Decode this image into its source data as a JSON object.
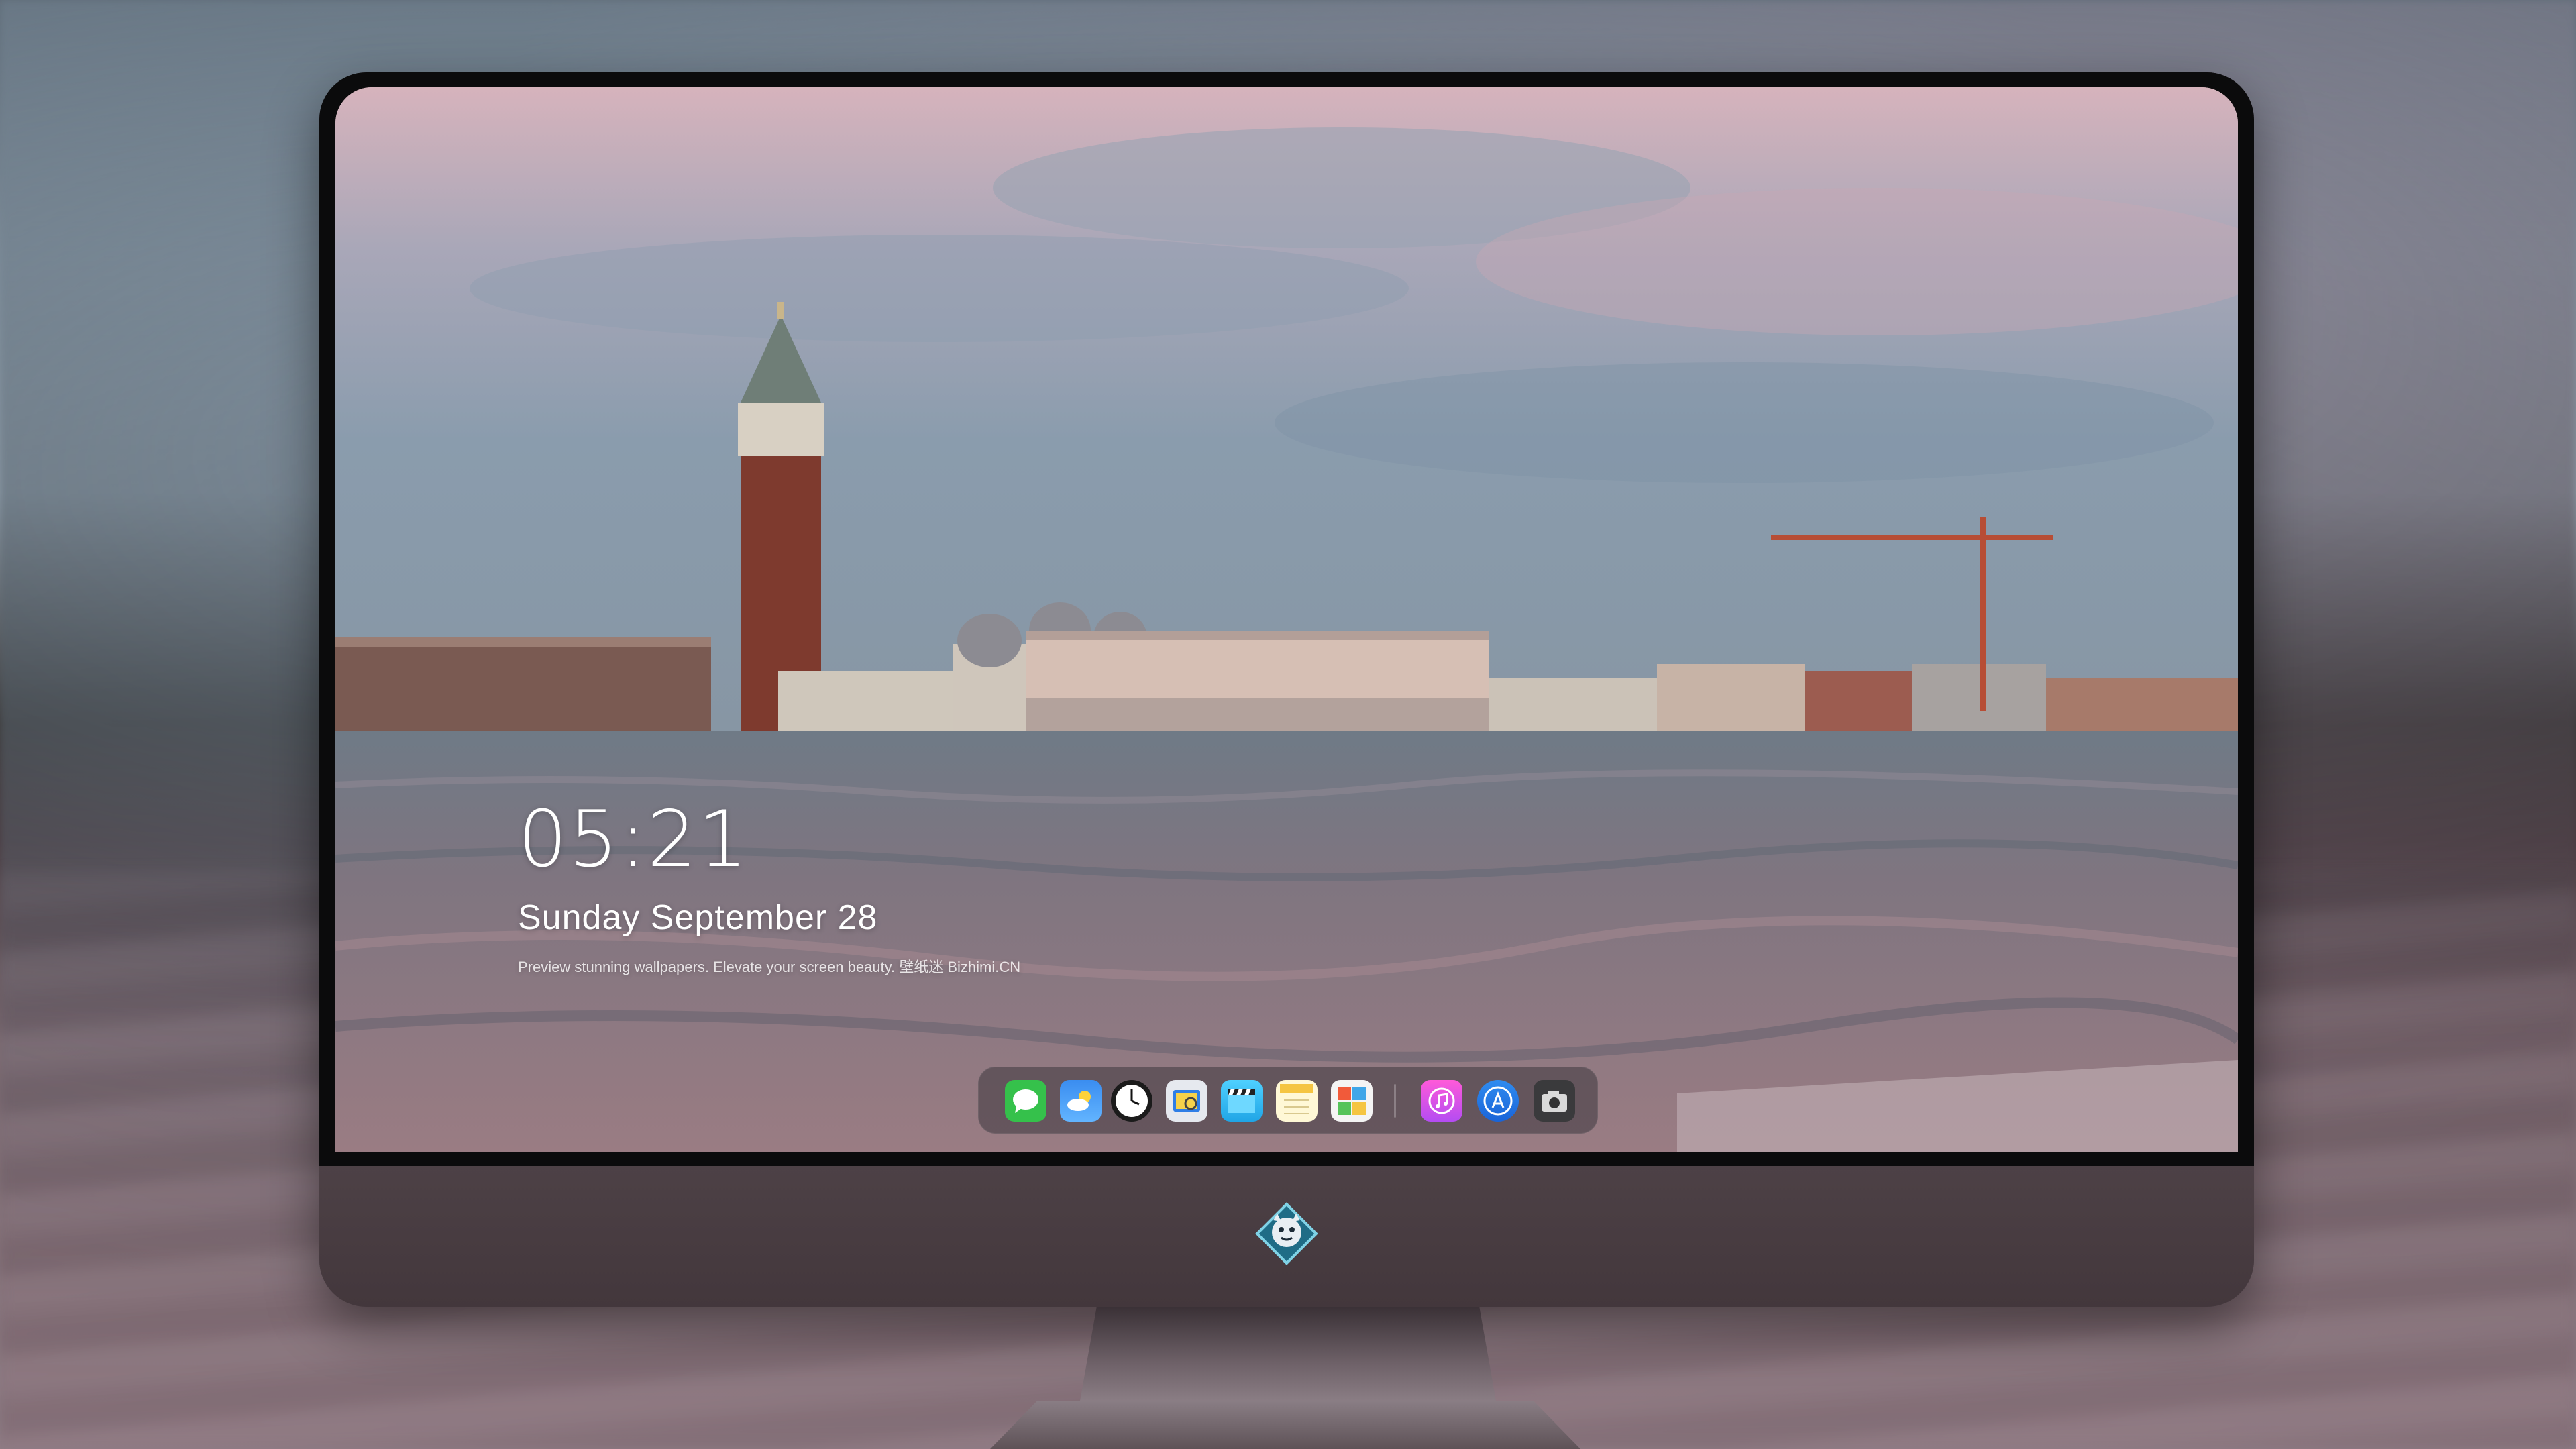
{
  "lock_screen": {
    "time": "05:21",
    "date": "Sunday September  28",
    "tagline": "Preview stunning wallpapers. Elevate your screen beauty. 壁纸迷  Bizhimi.CN"
  },
  "dock": {
    "apps": [
      {
        "icon": "messages-icon"
      },
      {
        "icon": "weather-icon"
      },
      {
        "icon": "clock-icon"
      },
      {
        "icon": "preview-icon"
      },
      {
        "icon": "clips-icon"
      },
      {
        "icon": "notes-icon"
      },
      {
        "icon": "photo-booth-icon"
      },
      {
        "icon": "music-icon"
      },
      {
        "icon": "app-store-icon"
      },
      {
        "icon": "camera-icon"
      }
    ]
  },
  "colors": {
    "monitor_chin": "#4a3f44",
    "bezel": "#0b0b0c",
    "sky_pink": "#d9b5bd",
    "water": "#8a747b"
  }
}
